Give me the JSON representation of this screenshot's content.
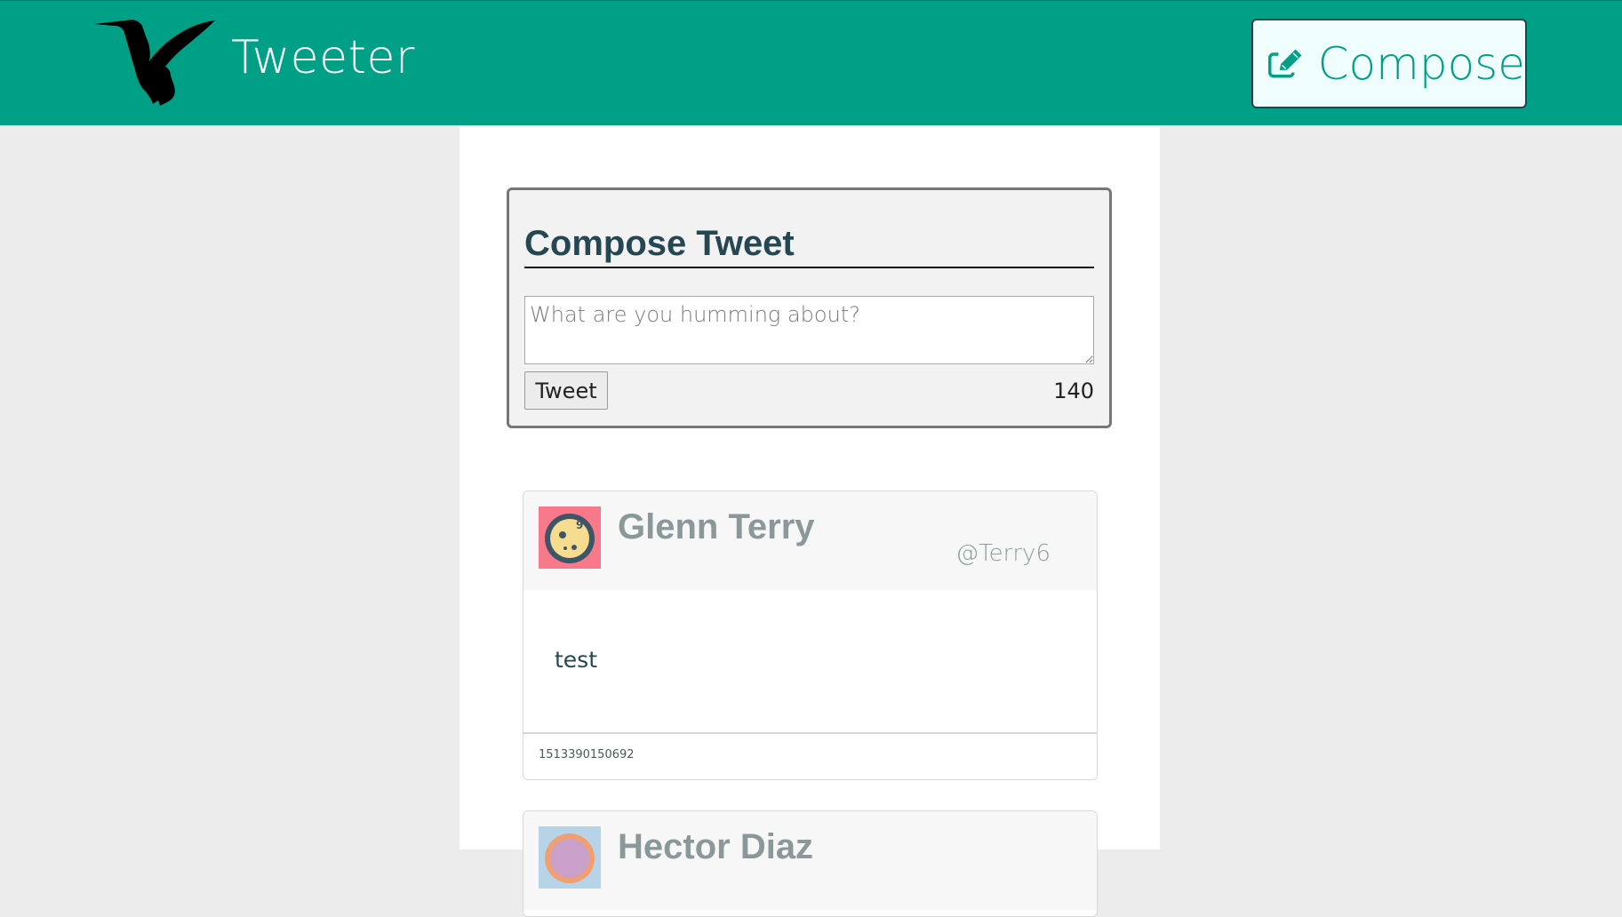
{
  "navbar": {
    "brand": "Tweeter",
    "logo_icon": "hummingbird-icon",
    "compose_icon": "edit-icon",
    "compose_label": "Compose"
  },
  "new_tweet": {
    "title": "Compose Tweet",
    "placeholder": "What are you humming about?",
    "value": "",
    "submit_label": "Tweet",
    "counter": "140"
  },
  "tweets": [
    {
      "name": "Glenn Terry",
      "handle": "@Terry6",
      "content": "test",
      "timestamp": "1513390150692",
      "avatar_colors": {
        "bg": "#f87a8a",
        "face": "#f6dc8e",
        "ring": "#3d5566"
      }
    },
    {
      "name": "Hector Diaz",
      "avatar_colors": {
        "bg": "#b7d3e8",
        "face": "#c9a0c9",
        "ring": "#f0a070"
      }
    }
  ],
  "colors": {
    "header_bg": "#00a087",
    "accent": "#00a087",
    "page_bg": "#ececec",
    "title_text": "#244751"
  }
}
